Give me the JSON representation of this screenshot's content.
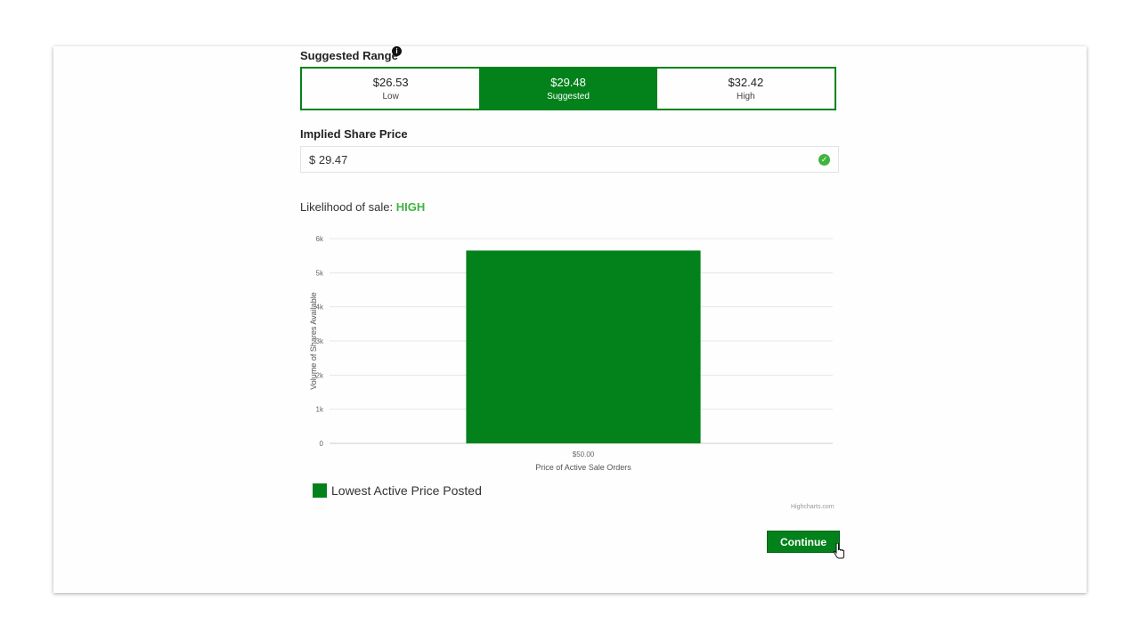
{
  "suggested_range": {
    "label": "Suggested Range",
    "info_icon": "info-icon",
    "options": [
      {
        "value": "$26.53",
        "label": "Low",
        "active": false
      },
      {
        "value": "$29.48",
        "label": "Suggested",
        "active": true
      },
      {
        "value": "$32.42",
        "label": "High",
        "active": false
      }
    ]
  },
  "implied_price": {
    "label": "Implied Share Price",
    "value": "$ 29.47",
    "status_icon": "check-circle-icon"
  },
  "likelihood": {
    "label": "Likelihood of sale:",
    "value": "HIGH"
  },
  "chart_data": {
    "type": "bar",
    "categories": [
      "$50.00"
    ],
    "values": [
      5650
    ],
    "series": [
      {
        "name": "Lowest Active Price Posted",
        "values": [
          5650
        ]
      }
    ],
    "ylabel": "Volume of Shares Available",
    "xlabel": "Price of Active Sale Orders",
    "ylim": [
      0,
      6000
    ],
    "yticks": [
      "0",
      "1k",
      "2k",
      "3k",
      "4k",
      "5k",
      "6k"
    ],
    "ytick_values": [
      0,
      1000,
      2000,
      3000,
      4000,
      5000,
      6000
    ],
    "grid": true,
    "legend_position": "bottom-left",
    "bar_color": "#03821b",
    "credits": "Highcharts.com"
  },
  "actions": {
    "continue_label": "Continue"
  },
  "colors": {
    "accent": "#03821b",
    "success": "#3fb53f"
  }
}
